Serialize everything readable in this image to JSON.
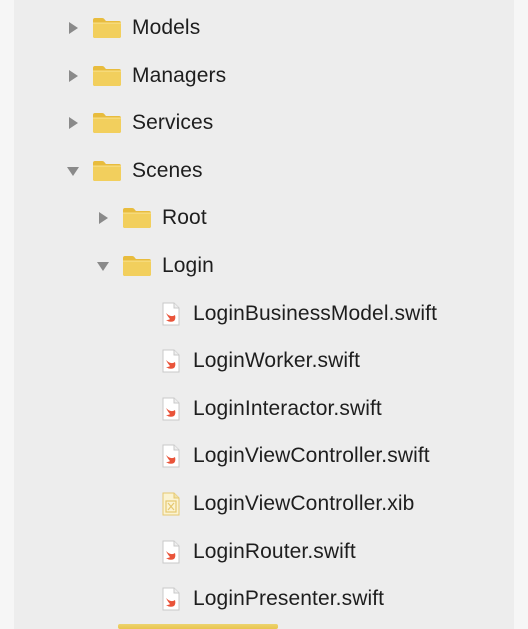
{
  "navigator": {
    "items": [
      {
        "label": "Models",
        "type": "folder",
        "expanded": false,
        "indent": 0
      },
      {
        "label": "Managers",
        "type": "folder",
        "expanded": false,
        "indent": 0
      },
      {
        "label": "Services",
        "type": "folder",
        "expanded": false,
        "indent": 0
      },
      {
        "label": "Scenes",
        "type": "folder",
        "expanded": true,
        "indent": 0
      },
      {
        "label": "Root",
        "type": "folder",
        "expanded": false,
        "indent": 1
      },
      {
        "label": "Login",
        "type": "folder",
        "expanded": true,
        "indent": 1
      },
      {
        "label": "LoginBusinessModel.swift",
        "type": "swift",
        "indent": 2
      },
      {
        "label": "LoginWorker.swift",
        "type": "swift",
        "indent": 2
      },
      {
        "label": "LoginInteractor.swift",
        "type": "swift",
        "indent": 2
      },
      {
        "label": "LoginViewController.swift",
        "type": "swift",
        "indent": 2
      },
      {
        "label": "LoginViewController.xib",
        "type": "xib",
        "indent": 2
      },
      {
        "label": "LoginRouter.swift",
        "type": "swift",
        "indent": 2
      },
      {
        "label": "LoginPresenter.swift",
        "type": "swift",
        "indent": 2
      }
    ]
  },
  "colors": {
    "folder_body": "#f2cf5d",
    "folder_tab": "#e8bc3d",
    "swift_icon": "#e9543a",
    "xib_icon": "#e6c870",
    "disclosure": "#8a8a8a",
    "text": "#1e1e1e"
  }
}
